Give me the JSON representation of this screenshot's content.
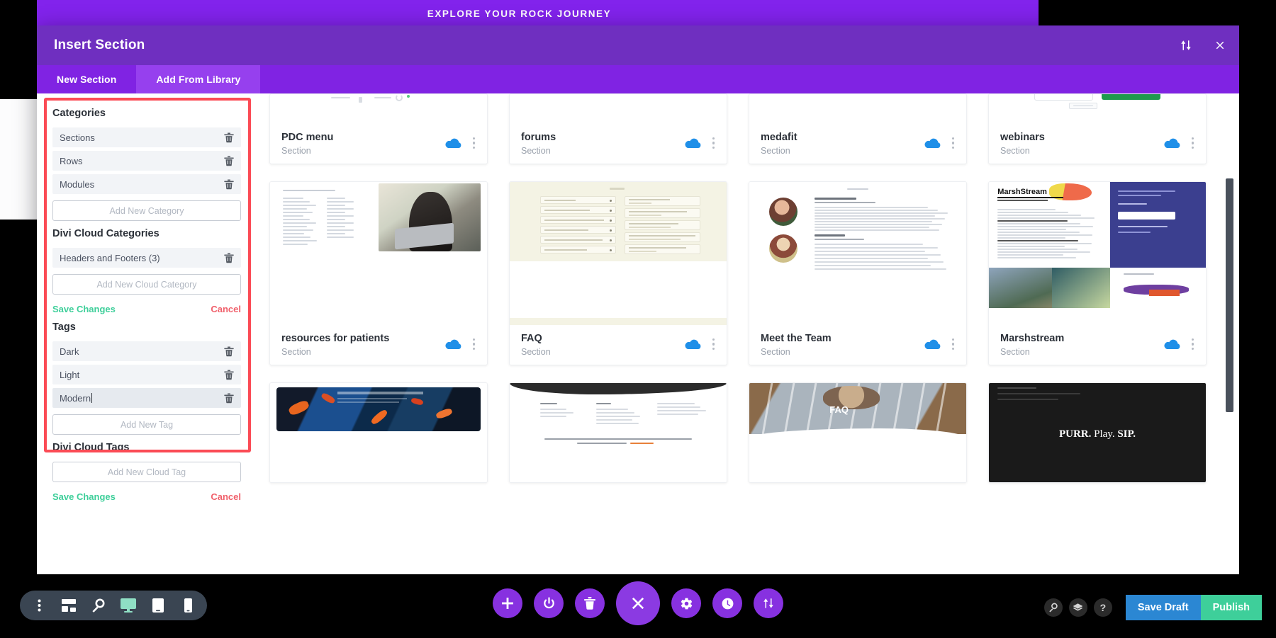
{
  "page": {
    "banner_text": "EXPLORE YOUR ROCK JOURNEY"
  },
  "modal": {
    "title": "Insert Section",
    "header_icons": [
      {
        "name": "sort-icon",
        "glyph": "sort"
      },
      {
        "name": "close-icon",
        "glyph": "close"
      }
    ],
    "tabs": [
      {
        "label": "New Section",
        "active": false
      },
      {
        "label": "Add From Library",
        "active": true
      }
    ]
  },
  "sidebar": {
    "categories_heading": "Categories",
    "categories": [
      {
        "label": "Sections",
        "editing": false
      },
      {
        "label": "Rows",
        "editing": false
      },
      {
        "label": "Modules",
        "editing": false
      }
    ],
    "add_category_label": "Add New Category",
    "cloud_categories_heading": "Divi Cloud Categories",
    "cloud_categories": [
      {
        "label": "Headers and Footers (3)",
        "editing": false
      }
    ],
    "add_cloud_category_label": "Add New Cloud Category",
    "category_save_label": "Save Changes",
    "category_cancel_label": "Cancel",
    "tags_heading": "Tags",
    "tags": [
      {
        "label": "Dark",
        "editing": false
      },
      {
        "label": "Light",
        "editing": false
      },
      {
        "label": "Modern",
        "editing": true
      }
    ],
    "add_tag_label": "Add New Tag",
    "cloud_tags_heading": "Divi Cloud Tags",
    "add_cloud_tag_label": "Add New Cloud Tag",
    "tag_save_label": "Save Changes",
    "tag_cancel_label": "Cancel"
  },
  "library": {
    "item_subtitle": "Section",
    "rows": [
      {
        "height_class": "row1",
        "items": [
          {
            "title": "PDC menu",
            "subtitle": "Section",
            "cloud": true,
            "thumb": "pdc"
          },
          {
            "title": "forums",
            "subtitle": "Section",
            "cloud": true,
            "thumb": "plain"
          },
          {
            "title": "medafit",
            "subtitle": "Section",
            "cloud": true,
            "thumb": "plain"
          },
          {
            "title": "webinars",
            "subtitle": "Section",
            "cloud": true,
            "thumb": "webinars"
          }
        ]
      },
      {
        "height_class": "row2",
        "items": [
          {
            "title": "resources for patients",
            "subtitle": "Section",
            "cloud": true,
            "thumb": "resources"
          },
          {
            "title": "FAQ",
            "subtitle": "Section",
            "cloud": true,
            "thumb": "faq"
          },
          {
            "title": "Meet the Team",
            "subtitle": "Section",
            "cloud": true,
            "thumb": "team"
          },
          {
            "title": "Marshstream",
            "subtitle": "Section",
            "cloud": true,
            "thumb": "marsh"
          }
        ]
      },
      {
        "height_class": "row3",
        "items": [
          {
            "title": "",
            "subtitle": "",
            "cloud": false,
            "thumb": "artcan"
          },
          {
            "title": "",
            "subtitle": "",
            "cloud": false,
            "thumb": "catdoc"
          },
          {
            "title": "",
            "subtitle": "",
            "cloud": false,
            "thumb": "catfaq"
          },
          {
            "title": "",
            "subtitle": "",
            "cloud": false,
            "thumb": "purr"
          }
        ]
      }
    ],
    "thumb_text": {
      "marsh_logo": "MarshStream",
      "faq_overlay": "FAQ",
      "purr_line": "PURR. Play. SIP."
    }
  },
  "bottom_bar": {
    "left_tools": [
      {
        "name": "more-options-icon"
      },
      {
        "name": "wireframe-icon"
      },
      {
        "name": "zoom-icon"
      },
      {
        "name": "desktop-icon"
      },
      {
        "name": "tablet-icon"
      },
      {
        "name": "phone-icon"
      }
    ],
    "center_tools": [
      {
        "name": "add-icon"
      },
      {
        "name": "power-icon"
      },
      {
        "name": "trash-icon"
      },
      {
        "name": "close-toolbar-icon"
      },
      {
        "name": "settings-icon"
      },
      {
        "name": "history-icon"
      },
      {
        "name": "portability-icon"
      }
    ],
    "right_tools": [
      {
        "name": "search-icon"
      },
      {
        "name": "layers-icon"
      },
      {
        "name": "help-icon",
        "label": "?"
      }
    ],
    "save_draft_label": "Save Draft",
    "publish_label": "Publish"
  },
  "colors": {
    "brand_purple": "#6f2fc0",
    "tab_purple": "#8023e3",
    "active_tab_purple": "#9640ee",
    "banner_purple": "#8223ec",
    "highlight_red": "#fb4b55",
    "cloud_blue": "#1f8fe8",
    "save_green": "#3ecf9a",
    "cancel_red": "#f0606b",
    "draft_blue": "#2b87d3",
    "toolbar_purple": "#8731e0"
  }
}
